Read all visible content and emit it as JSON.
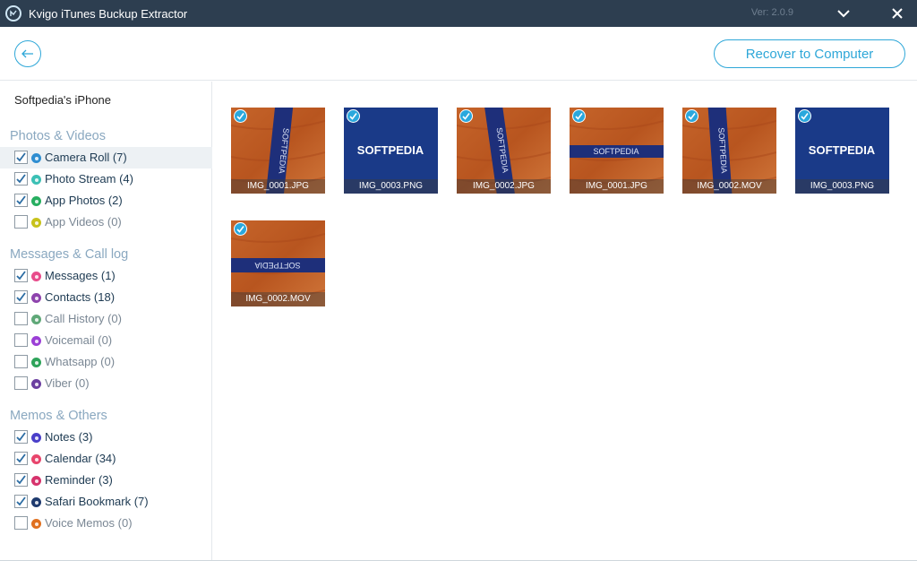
{
  "window": {
    "title": "Kvigo iTunes Buckup Extractor",
    "version": "Ver: 2.0.9",
    "minimize_icon": "chevron-down-icon",
    "close_icon": "close-icon"
  },
  "header": {
    "back_icon": "back-arrow-icon",
    "recover_label": "Recover to Computer"
  },
  "sidebar": {
    "device": "Softpedia's iPhone",
    "groups": [
      {
        "title": "Photos & Videos",
        "items": [
          {
            "label": "Camera Roll (7)",
            "checked": true,
            "color": "#2f8ed1",
            "selected": true
          },
          {
            "label": "Photo Stream (4)",
            "checked": true,
            "color": "#3cc0b5"
          },
          {
            "label": "App Photos (2)",
            "checked": true,
            "color": "#27ae60"
          },
          {
            "label": "App Videos (0)",
            "checked": false,
            "color": "#c7c21b"
          }
        ]
      },
      {
        "title": "Messages & Call log",
        "items": [
          {
            "label": "Messages (1)",
            "checked": true,
            "color": "#e84c8b"
          },
          {
            "label": "Contacts (18)",
            "checked": true,
            "color": "#8e44ad"
          },
          {
            "label": "Call History (0)",
            "checked": false,
            "color": "#5fa878"
          },
          {
            "label": "Voicemail (0)",
            "checked": false,
            "color": "#9b3fd6"
          },
          {
            "label": "Whatsapp (0)",
            "checked": false,
            "color": "#2ea35a"
          },
          {
            "label": "Viber (0)",
            "checked": false,
            "color": "#6b3fa0"
          }
        ]
      },
      {
        "title": "Memos & Others",
        "items": [
          {
            "label": "Notes (3)",
            "checked": true,
            "color": "#4a3fc9"
          },
          {
            "label": "Calendar (34)",
            "checked": true,
            "color": "#e8456c"
          },
          {
            "label": "Reminder (3)",
            "checked": true,
            "color": "#d6336c"
          },
          {
            "label": "Safari Bookmark (7)",
            "checked": true,
            "color": "#1e3a6e"
          },
          {
            "label": "Voice Memos (0)",
            "checked": false,
            "color": "#e0701f"
          }
        ]
      }
    ]
  },
  "thumbnails": [
    {
      "name": "IMG_0001.JPG",
      "kind": "strap-vertical"
    },
    {
      "name": "IMG_0003.PNG",
      "kind": "logo"
    },
    {
      "name": "IMG_0002.JPG",
      "kind": "strap-vertical-2"
    },
    {
      "name": "IMG_0001.JPG",
      "kind": "strap-horizontal"
    },
    {
      "name": "IMG_0002.MOV",
      "kind": "strap-vertical-3"
    },
    {
      "name": "IMG_0003.PNG",
      "kind": "logo"
    },
    {
      "name": "IMG_0002.MOV",
      "kind": "strap-horizontal-2"
    }
  ],
  "logo_text": "SOFTPEDIA",
  "strap_text": "SOFTPEDIA"
}
